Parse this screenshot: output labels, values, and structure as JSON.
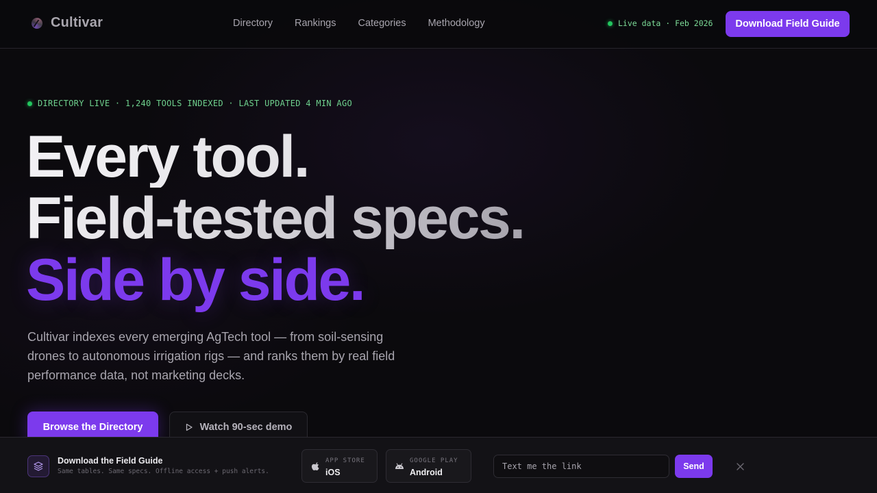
{
  "nav": {
    "brand": "Cultivar",
    "links": [
      "Directory",
      "Rankings",
      "Categories",
      "Methodology"
    ],
    "live_label": "Live data · Feb 2026",
    "cta_label": "Download Field Guide"
  },
  "hero": {
    "status": "DIRECTORY LIVE · 1,240 TOOLS INDEXED · LAST UPDATED 4 MIN AGO",
    "headline_1": "Every tool.",
    "headline_2": "Field-tested specs.",
    "headline_3": "Side by side.",
    "lede": "Cultivar indexes every emerging AgTech tool — from soil-sensing drones to autonomous irrigation rigs — and ranks them by real field performance data, not marketing decks.",
    "primary_cta": "Browse the Directory",
    "secondary_cta": "Watch 90-sec demo"
  },
  "download_bar": {
    "title": "Download the Field Guide",
    "subtitle": "Same tables. Same specs. Offline access + push alerts.",
    "ios_eyebrow": "APP STORE",
    "ios_label": "iOS",
    "android_eyebrow": "GOOGLE PLAY",
    "android_label": "Android",
    "sms_placeholder": "Text me the link",
    "send_label": "Send",
    "close_icon": "close-icon"
  },
  "colors": {
    "accent": "#7c3aed",
    "live_green": "#22c55e",
    "background": "#0b0a0d"
  }
}
